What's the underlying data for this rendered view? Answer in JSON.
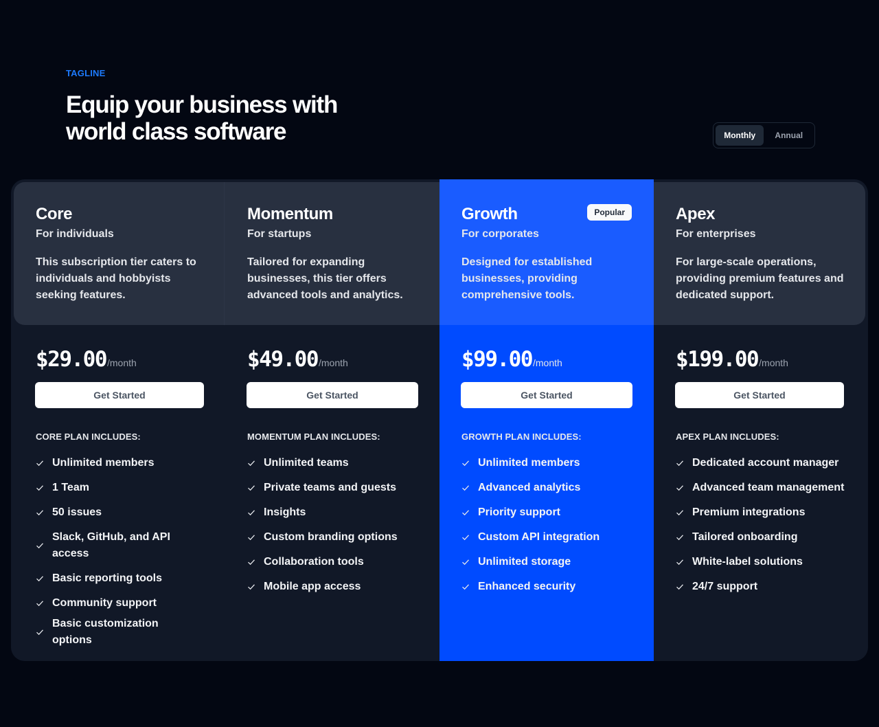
{
  "header": {
    "tagline": "TAGLINE",
    "title": "Equip your business with world class software"
  },
  "billing_toggle": {
    "options": [
      {
        "label": "Monthly",
        "active": true
      },
      {
        "label": "Annual",
        "active": false
      }
    ]
  },
  "colors": {
    "accent": "#1d7afc",
    "featured_bg": "#004bff",
    "featured_header_bg": "#1a5cff",
    "background": "#030712",
    "card_bg": "#111827",
    "header_band_bg": "#283040"
  },
  "plans": [
    {
      "name": "Core",
      "audience": "For individuals",
      "description": "This subscription tier caters to individuals and hobbyists seeking features.",
      "price": "$29.00",
      "period": "/month",
      "cta": "Get Started",
      "includes_label": "CORE PLAN INCLUDES:",
      "features": [
        "Unlimited members",
        "1 Team",
        "50 issues",
        "Slack, GitHub, and API access",
        "Basic reporting tools",
        "Community support",
        "Basic customization options"
      ]
    },
    {
      "name": "Momentum",
      "audience": "For startups",
      "description": "Tailored for expanding businesses, this tier offers advanced tools and analytics.",
      "price": "$49.00",
      "period": "/month",
      "cta": "Get Started",
      "includes_label": "MOMENTUM PLAN INCLUDES:",
      "features": [
        "Unlimited teams",
        "Private teams and guests",
        "Insights",
        "Custom branding options",
        "Collaboration tools",
        "Mobile app access"
      ]
    },
    {
      "name": "Growth",
      "audience": "For corporates",
      "description": "Designed for established businesses, providing comprehensive tools.",
      "badge": "Popular",
      "price": "$99.00",
      "period": "/month",
      "cta": "Get Started",
      "includes_label": "GROWTH PLAN INCLUDES:",
      "features": [
        "Unlimited members",
        "Advanced analytics",
        "Priority support",
        "Custom API integration",
        "Unlimited storage",
        "Enhanced security"
      ]
    },
    {
      "name": "Apex",
      "audience": "For enterprises",
      "description": "For large-scale operations, providing premium features and dedicated support.",
      "price": "$199.00",
      "period": "/month",
      "cta": "Get Started",
      "includes_label": "APEX PLAN INCLUDES:",
      "features": [
        "Dedicated account manager",
        "Advanced team management",
        "Premium integrations",
        "Tailored onboarding",
        "White-label solutions",
        "24/7 support"
      ]
    }
  ]
}
